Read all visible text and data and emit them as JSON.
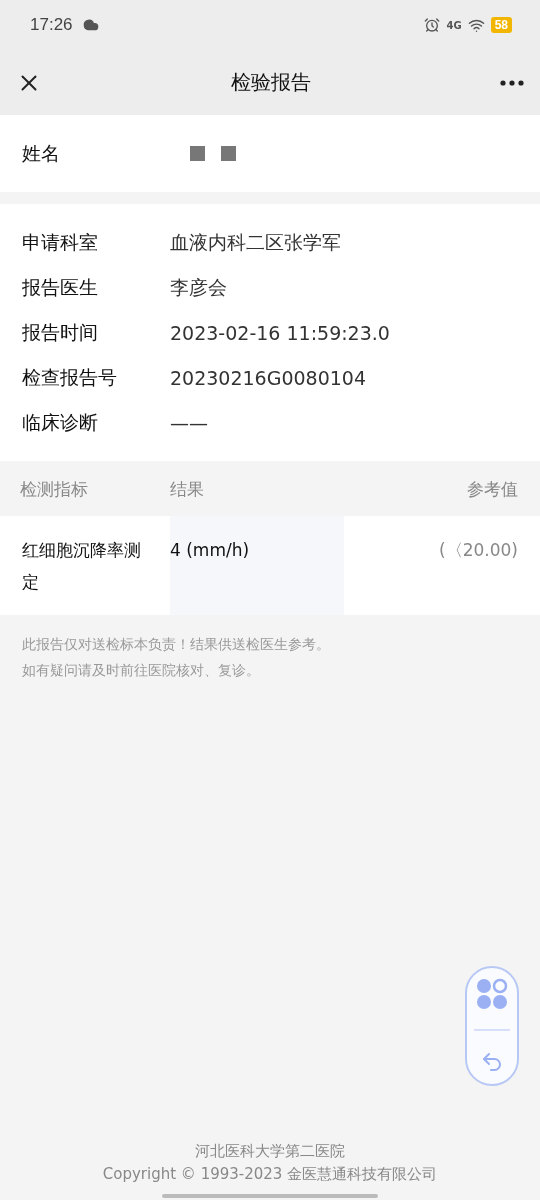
{
  "status_bar": {
    "time": "17:26",
    "network": "4G",
    "battery": "58"
  },
  "header": {
    "title": "检验报告"
  },
  "patient": {
    "label": "姓名",
    "redacted": true
  },
  "info": [
    {
      "label": "申请科室",
      "value": "血液内科二区张学军"
    },
    {
      "label": "报告医生",
      "value": "李彦会"
    },
    {
      "label": "报告时间",
      "value": "2023-02-16 11:59:23.0"
    },
    {
      "label": "检查报告号",
      "value": "20230216G0080104"
    },
    {
      "label": "临床诊断",
      "value": "——"
    }
  ],
  "table": {
    "columns": [
      "检测指标",
      "结果",
      "参考值"
    ],
    "rows": [
      {
        "item": "红细胞沉降率测定",
        "result": "4",
        "unit": "(mm/h)",
        "reference": "(〈20.00)"
      }
    ]
  },
  "notes": [
    "此报告仅对送检标本负责！结果供送检医生参考。",
    "如有疑问请及时前往医院核对、复诊。"
  ],
  "footer": {
    "hospital": "河北医科大学第二医院",
    "copyright": "Copyright © 1993-2023 金医慧通科技有限公司"
  }
}
